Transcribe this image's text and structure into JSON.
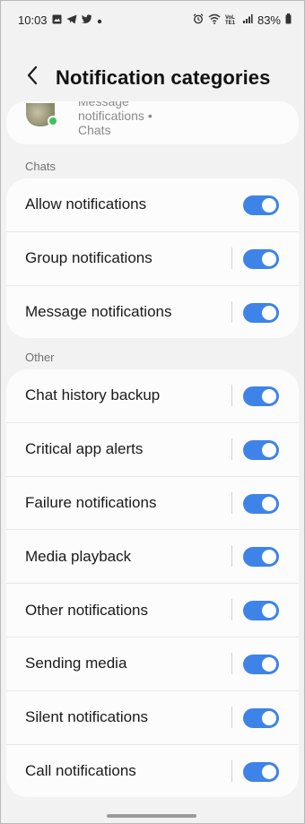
{
  "status_bar": {
    "time": "10:03",
    "left_icons": [
      "gallery-icon",
      "telegram-icon",
      "twitter-icon",
      "dot-icon"
    ],
    "right_icons": [
      "alarm-icon",
      "wifi-icon",
      "volte-icon",
      "signal-icon",
      "battery-icon"
    ],
    "volte_label": "VoLTE1",
    "battery": "83%"
  },
  "header": {
    "back_icon": "chevron-left-icon",
    "title": "Notification categories"
  },
  "partial_card": {
    "line1": "Message",
    "line2": "notifications •",
    "line3": "Chats"
  },
  "sections": [
    {
      "label": "Chats",
      "items": [
        {
          "label": "Allow notifications",
          "enabled": true,
          "divider": false
        },
        {
          "label": "Group notifications",
          "enabled": true,
          "divider": true
        },
        {
          "label": "Message notifications",
          "enabled": true,
          "divider": true
        }
      ]
    },
    {
      "label": "Other",
      "items": [
        {
          "label": "Chat history backup",
          "enabled": true,
          "divider": true
        },
        {
          "label": "Critical app alerts",
          "enabled": true,
          "divider": true
        },
        {
          "label": "Failure notifications",
          "enabled": true,
          "divider": true
        },
        {
          "label": "Media playback",
          "enabled": true,
          "divider": true
        },
        {
          "label": "Other notifications",
          "enabled": true,
          "divider": true
        },
        {
          "label": "Sending media",
          "enabled": true,
          "divider": true
        },
        {
          "label": "Silent notifications",
          "enabled": true,
          "divider": true
        },
        {
          "label": "Call notifications",
          "enabled": true,
          "divider": true
        }
      ]
    }
  ],
  "colors": {
    "accent": "#3e83e8",
    "background": "#f2f2f2",
    "card": "#fcfcfc"
  }
}
